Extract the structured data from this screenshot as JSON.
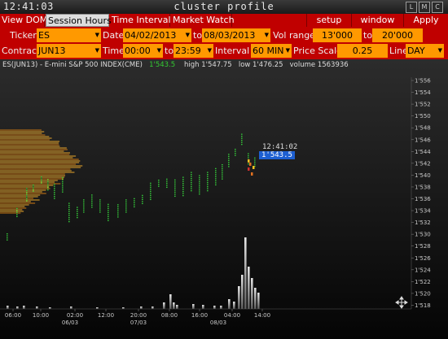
{
  "window": {
    "clock": "12:41:03",
    "title": "cluster profile",
    "buttons": [
      "L",
      "M",
      "C"
    ]
  },
  "menu": {
    "view_dom": "View DOM",
    "session_hours": "Session Hours",
    "time_interval": "Time Interval",
    "market_watch": "Market Watch",
    "setup": "setup",
    "window": "window",
    "apply": "Apply"
  },
  "params": {
    "ticker_label": "Ticker",
    "ticker": "ES",
    "date_label": "Date",
    "date_from": "04/02/2013",
    "to_label": "to",
    "date_to": "08/03/2013",
    "vol_range_label": "Vol range",
    "vol_from": "13'000",
    "vol_to": "20'000",
    "contract_label": "Contract",
    "contract": "JUN13",
    "time_label": "Time",
    "time_from": "00:00",
    "time_to": "23:59",
    "interval_label": "Interval",
    "interval": "60 MIN",
    "price_scale_label": "Price Scale",
    "price_scale": "0.25",
    "line_label": "Line",
    "line": "DAY"
  },
  "chart_info": {
    "symbol": "ES(JUN13) - E-mini S&P 500 INDEX(CME)",
    "last": "1'543.5",
    "high_text": "high 1'547.75",
    "low_text": "low 1'476.25",
    "volume_text": "volume 1563936"
  },
  "overlay": {
    "time": "12:41:02",
    "last_price": "1'543.5"
  },
  "colors": {
    "menu_red": "#c00000",
    "field_orange": "#ff9900",
    "price_green": "#33cc33",
    "profile_orange": "#e89a1a",
    "last_price_blue": "#1d5fd1"
  },
  "chart_data": {
    "type": "bar",
    "y_ticks": [
      "1'556",
      "1'554",
      "1'552",
      "1'550",
      "1'548",
      "1'546",
      "1'544",
      "1'542",
      "1'540",
      "1'538",
      "1'536",
      "1'534",
      "1'532",
      "1'530",
      "1'528",
      "1'526",
      "1'524",
      "1'522",
      "1'520",
      "1'518"
    ],
    "x_ticks": [
      "06:00",
      "10:00",
      "02:00",
      "12:00",
      "20:00",
      "08:00",
      "16:00",
      "04:00",
      "14:00"
    ],
    "date_labels": [
      "06/03",
      "07/03",
      "08/03"
    ],
    "ylim": [
      1517,
      1557
    ]
  }
}
